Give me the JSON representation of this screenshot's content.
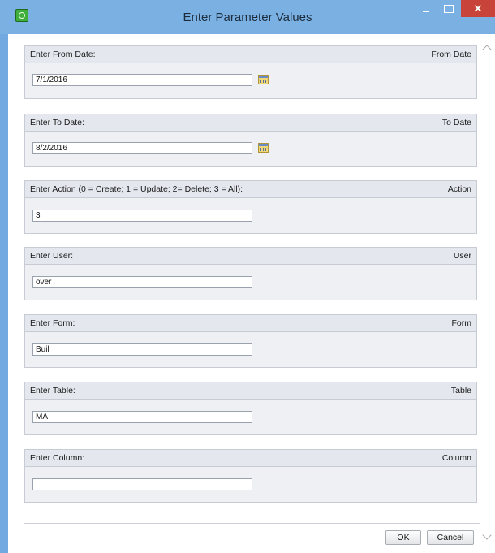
{
  "window": {
    "title": "Enter Parameter Values",
    "close_glyph": "✕",
    "icons": {
      "app": "app-icon",
      "minimize": "minimize-icon",
      "maximize": "maximize-icon",
      "close": "close-icon"
    }
  },
  "panels": [
    {
      "label": "Enter From Date:",
      "name": "From Date",
      "value": "7/1/2016",
      "has_calendar": true
    },
    {
      "label": "Enter To Date:",
      "name": "To Date",
      "value": "8/2/2016",
      "has_calendar": true
    },
    {
      "label": "Enter Action (0 = Create; 1 = Update; 2= Delete; 3 = All):",
      "name": "Action",
      "value": "3",
      "has_calendar": false
    },
    {
      "label": "Enter User:",
      "name": "User",
      "value": "over",
      "has_calendar": false
    },
    {
      "label": "Enter Form:",
      "name": "Form",
      "value": "Buil",
      "has_calendar": false
    },
    {
      "label": "Enter Table:",
      "name": "Table",
      "value": "MA",
      "has_calendar": false
    },
    {
      "label": "Enter Column:",
      "name": "Column",
      "value": "",
      "has_calendar": false
    }
  ],
  "buttons": {
    "ok": "OK",
    "cancel": "Cancel"
  }
}
